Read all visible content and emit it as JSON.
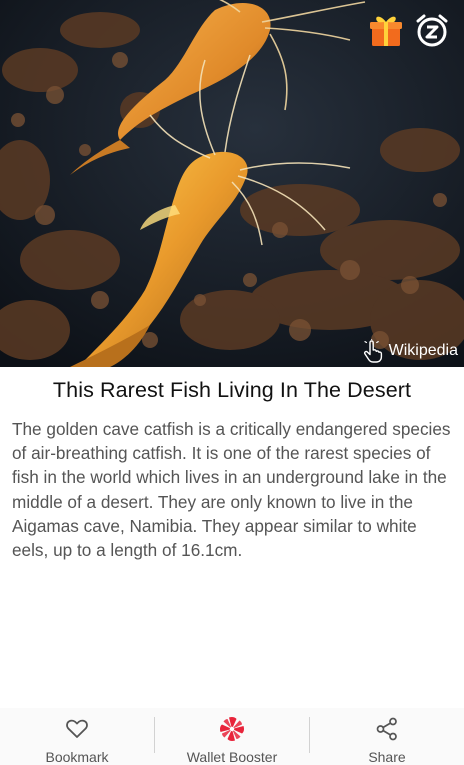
{
  "hero": {
    "source_label": "Wikipedia",
    "icons": {
      "gift": "gift-icon",
      "snooze": "snooze-icon",
      "tap": "tap-icon"
    }
  },
  "article": {
    "title": "This Rarest Fish Living In The Desert",
    "body": "The golden cave catfish is a critically endangered species of air-breathing catfish. It is one of the rarest species of fish in the world which lives in an underground lake in the middle of a desert. They are only known to live in the Aigamas cave, Namibia. They appear similar to white eels, up to a length of 16.1cm."
  },
  "bottom_bar": {
    "bookmark_label": "Bookmark",
    "wallet_label": "Wallet Booster",
    "share_label": "Share",
    "icons": {
      "bookmark": "heart-icon",
      "wallet": "pinwheel-icon",
      "share": "share-icon"
    }
  },
  "colors": {
    "accent_red": "#e8243b",
    "gift_orange": "#f26b1d",
    "text_dark": "#111111",
    "text_body": "#555555"
  }
}
